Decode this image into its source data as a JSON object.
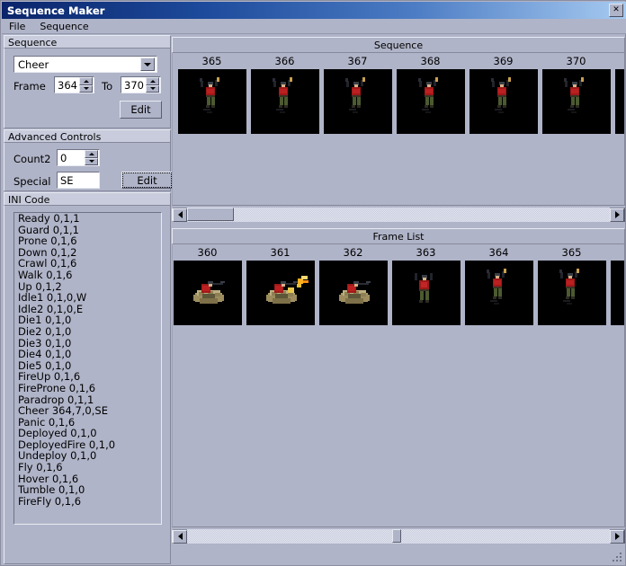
{
  "window": {
    "title": "Sequence Maker",
    "close_label": "✕"
  },
  "menubar": {
    "items": [
      {
        "label": "File"
      },
      {
        "label": "Sequence"
      }
    ]
  },
  "sequence_group": {
    "title": "Sequence",
    "combo": {
      "value": "Cheer",
      "icon": "chevron-down-icon"
    },
    "frame_label": "Frame",
    "frame_value": "364",
    "to_label": "To",
    "to_value": "370",
    "edit_label": "Edit"
  },
  "advanced_group": {
    "title": "Advanced Controls",
    "count2_label": "Count2",
    "count2_value": "0",
    "special_label": "Special",
    "special_value": "SE",
    "edit_label": "Edit"
  },
  "ini_group": {
    "title": "INI Code",
    "lines": [
      "Ready 0,1,1",
      "Guard 0,1,1",
      "Prone 0,1,6",
      "Down 0,1,2",
      "Crawl 0,1,6",
      "Walk 0,1,6",
      "Up 0,1,2",
      "Idle1 0,1,0,W",
      "Idle2 0,1,0,E",
      "Die1 0,1,0",
      "Die2 0,1,0",
      "Die3 0,1,0",
      "Die4 0,1,0",
      "Die5 0,1,0",
      "FireUp 0,1,6",
      "FireProne 0,1,6",
      "Paradrop 0,1,1",
      "Cheer 364,7,0,SE",
      "Panic 0,1,6",
      "Deployed 0,1,0",
      "DeployedFire 0,1,0",
      "Undeploy 0,1,0",
      "Fly 0,1,6",
      "Hover 0,1,6",
      "Tumble 0,1,0",
      "FireFly 0,1,6"
    ]
  },
  "sequence_panel": {
    "title": "Sequence",
    "frames": [
      {
        "number": "365",
        "sprite": "cheer"
      },
      {
        "number": "366",
        "sprite": "cheer"
      },
      {
        "number": "367",
        "sprite": "cheer"
      },
      {
        "number": "368",
        "sprite": "cheer"
      },
      {
        "number": "369",
        "sprite": "cheer"
      },
      {
        "number": "370",
        "sprite": "cheer"
      }
    ],
    "scrollbar": {
      "left_icon": "arrow-left-icon",
      "right_icon": "arrow-right-icon"
    }
  },
  "framelist_panel": {
    "title": "Frame List",
    "frames": [
      {
        "number": "360",
        "sprite": "nest"
      },
      {
        "number": "361",
        "sprite": "nest-fire"
      },
      {
        "number": "362",
        "sprite": "nest"
      },
      {
        "number": "363",
        "sprite": "stand"
      },
      {
        "number": "364",
        "sprite": "cheer"
      },
      {
        "number": "365",
        "sprite": "cheer"
      }
    ],
    "scrollbar": {
      "left_icon": "arrow-left-icon",
      "right_icon": "arrow-right-icon"
    }
  },
  "colors": {
    "face": "#b0b4c8",
    "title_start": "#0a246a",
    "title_end": "#a6caf0",
    "thumb_bg": "#000000",
    "sprite_shirt": "#a01818",
    "sprite_pants": "#4c5a30",
    "sprite_skin": "#d8b088",
    "sprite_sand": "#a89868",
    "sprite_flash": "#ffb020"
  }
}
